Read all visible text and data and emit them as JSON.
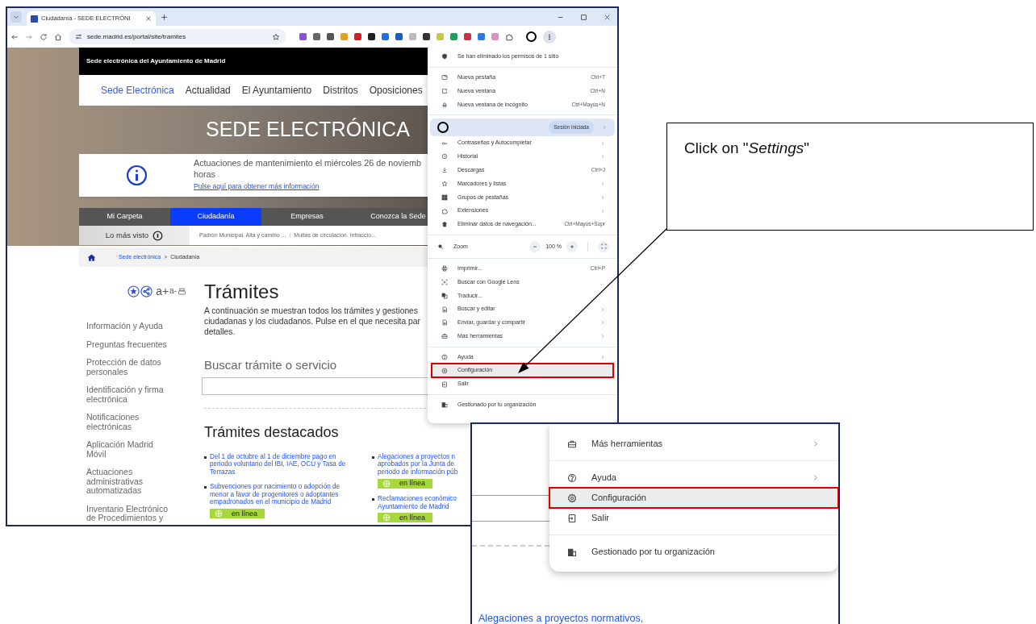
{
  "browser": {
    "tab_title": "Ciudadanía - SEDE ELECTRÓNI",
    "url": "sede.madrid.es/portal/site/tramites"
  },
  "site": {
    "header": "Sede electrónica del Ayuntamiento de Madrid",
    "nav": [
      {
        "label": "Sede Electrónica",
        "selected": true
      },
      {
        "label": "Actualidad",
        "selected": false
      },
      {
        "label": "El Ayuntamiento",
        "selected": false
      },
      {
        "label": "Distritos",
        "selected": false
      },
      {
        "label": "Oposiciones",
        "selected": false
      }
    ],
    "hero_title": "SEDE ELECTRÓNICA",
    "notice": {
      "lines": [
        "Actuaciones de mantenimiento el miércoles 26 de noviemb",
        "horas"
      ],
      "link": "Pulse aquí para obtener más información"
    },
    "sections": [
      {
        "label": "Mi Carpeta",
        "selected": false
      },
      {
        "label": "Ciudadanía",
        "selected": true
      },
      {
        "label": "Empresas",
        "selected": false
      },
      {
        "label": "Conozca la Sede",
        "selected": false
      }
    ],
    "most_viewed": {
      "label": "Lo más visto",
      "links": [
        "Padrón Municipal. Alta y cambio ...",
        "Multas de circulación. Infraccio..."
      ],
      "separator": "/"
    },
    "breadcrumb": {
      "items": [
        "Sede electrónica",
        "Ciudadanía"
      ],
      "separator": ">"
    },
    "tools": {
      "increase": "a+",
      "decrease": "a-"
    },
    "sidebar": [
      {
        "lines": [
          "Información y Ayuda"
        ]
      },
      {
        "lines": [
          "Preguntas frecuentes"
        ]
      },
      {
        "lines": [
          "Protección de datos",
          "personales"
        ]
      },
      {
        "lines": [
          "Identificación y firma",
          "electrónica"
        ]
      },
      {
        "lines": [
          "Notificaciones",
          "electrónicas"
        ]
      },
      {
        "lines": [
          "Aplicación Madrid",
          "Móvil"
        ]
      },
      {
        "lines": [
          "Actuaciones",
          "administrativas",
          "automatizadas"
        ]
      },
      {
        "lines": [
          "Inventario Electrónico",
          "de Procedimientos y"
        ]
      }
    ],
    "main": {
      "title": "Trámites",
      "intro_lines": [
        "A continuación se muestran todos los trámites y gestiones",
        "ciudadanas y los ciudadanos. Pulse en el que necesita par",
        "detalles."
      ],
      "search_label": "Buscar trámite o servicio",
      "featured_title": "Trámites destacados",
      "featured_columns": [
        [
          {
            "lines": [
              "Del 1 de octubre al 1 de diciembre pago en",
              "periodo voluntario del IBI, IAE, OCU y Tasa de",
              "Terrazas"
            ]
          },
          {
            "lines": [
              "Subvenciones por nacimiento o adopción de",
              "menor a favor de progenitores o adoptantes",
              "empadronados en el municipio de Madrid"
            ],
            "badge": "en línea"
          }
        ],
        [
          {
            "lines": [
              "Alegaciones a proyectos n",
              "aprobados por la Junta de",
              "periodo de información púb"
            ],
            "badge": "en línea"
          },
          {
            "lines": [
              "Reclamaciones económico",
              "Ayuntamiento de Madrid"
            ],
            "badge": "en línea"
          }
        ]
      ]
    }
  },
  "menu": {
    "groups": [
      [
        {
          "kind": "notice",
          "label": "Se han eliminado los permisos de 1 sitio",
          "selected": false
        }
      ],
      [
        {
          "kind": "item",
          "label": "Nueva pestaña",
          "shortcut": "Ctrl+T",
          "submenu": false,
          "selected": false
        },
        {
          "kind": "item",
          "label": "Nueva ventana",
          "shortcut": "Ctrl+N",
          "submenu": false,
          "selected": false
        },
        {
          "kind": "item",
          "label": "Nueva ventana de incógnito",
          "shortcut": "Ctrl+Mayús+N",
          "submenu": false,
          "selected": false
        }
      ],
      [
        {
          "kind": "profile",
          "label": "Sesión iniciada",
          "submenu": true,
          "selected": false
        },
        {
          "kind": "item",
          "label": "Contraseñas y Autocompletar",
          "submenu": true,
          "selected": false
        },
        {
          "kind": "item",
          "label": "Historial",
          "submenu": true,
          "selected": false
        },
        {
          "kind": "item",
          "label": "Descargas",
          "shortcut": "Ctrl+J",
          "submenu": false,
          "selected": false
        },
        {
          "kind": "item",
          "label": "Marcadores y listas",
          "submenu": true,
          "selected": false
        },
        {
          "kind": "item",
          "label": "Grupos de pestañas",
          "submenu": true,
          "selected": false
        },
        {
          "kind": "item",
          "label": "Extensiones",
          "submenu": true,
          "selected": false
        },
        {
          "kind": "item",
          "label": "Eliminar datos de navegación...",
          "shortcut": "Ctrl+Mayús+Supr",
          "submenu": false,
          "selected": false
        }
      ],
      [
        {
          "kind": "zoom",
          "label": "Zoom",
          "value": "100 %",
          "selected": false
        }
      ],
      [
        {
          "kind": "item",
          "label": "Imprimir...",
          "shortcut": "Ctrl+P",
          "submenu": false,
          "selected": false
        },
        {
          "kind": "item",
          "label": "Buscar con Google Lens",
          "submenu": false,
          "selected": false
        },
        {
          "kind": "item",
          "label": "Traducir...",
          "submenu": false,
          "selected": false
        },
        {
          "kind": "item",
          "label": "Buscar y editar",
          "submenu": true,
          "selected": false
        },
        {
          "kind": "item",
          "label": "Enviar, guardar y compartir",
          "submenu": true,
          "selected": false
        },
        {
          "kind": "item",
          "label": "Más herramientas",
          "submenu": true,
          "selected": false
        }
      ],
      [
        {
          "kind": "item",
          "label": "Ayuda",
          "submenu": true,
          "selected": false
        },
        {
          "kind": "item",
          "label": "Configuración",
          "submenu": false,
          "selected": true
        },
        {
          "kind": "item",
          "label": "Salir",
          "submenu": false,
          "selected": false
        }
      ],
      [
        {
          "kind": "item",
          "label": "Gestionado por tu organización",
          "submenu": false,
          "selected": false
        }
      ]
    ]
  },
  "callout": {
    "text": "Click on \"*Settings*\""
  },
  "inset": {
    "groups": [
      [
        {
          "kind": "item",
          "label": "Más herramientas",
          "submenu": true,
          "selected": false
        }
      ],
      [
        {
          "kind": "item",
          "label": "Ayuda",
          "submenu": true,
          "selected": false
        },
        {
          "kind": "item",
          "label": "Configuración",
          "submenu": false,
          "selected": true
        },
        {
          "kind": "item",
          "label": "Salir",
          "submenu": false,
          "selected": false
        }
      ],
      [
        {
          "kind": "item",
          "label": "Gestionado por tu organización",
          "submenu": false,
          "selected": false
        }
      ]
    ],
    "link": "Alegaciones a proyectos normativos,"
  }
}
